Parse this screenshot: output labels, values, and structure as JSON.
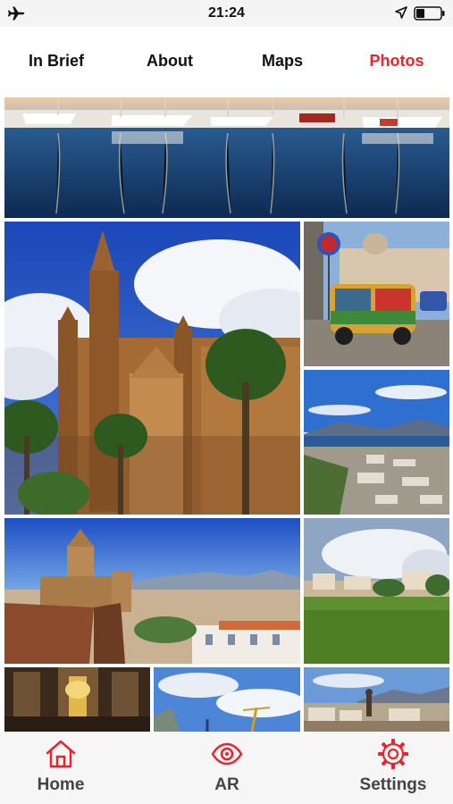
{
  "status_bar": {
    "time": "21:24",
    "left_icon": "airplane-icon",
    "right_icons": [
      "location-arrow-icon",
      "battery-icon"
    ]
  },
  "tabs": [
    {
      "label": "In Brief",
      "active": false
    },
    {
      "label": "About",
      "active": false
    },
    {
      "label": "Maps",
      "active": false
    },
    {
      "label": "Photos",
      "active": true
    }
  ],
  "accent_color": "#e8242d",
  "photos": [
    {
      "subject": "harbor-boats"
    },
    {
      "subject": "cathedral"
    },
    {
      "subject": "tuk-tuk"
    },
    {
      "subject": "aerial-coast"
    },
    {
      "subject": "cathedral-rooftops"
    },
    {
      "subject": "park-lawn"
    },
    {
      "subject": "church-interior"
    },
    {
      "subject": "sky-cranes"
    },
    {
      "subject": "city-mountains"
    }
  ],
  "bottom_nav": [
    {
      "label": "Home",
      "icon": "home-icon"
    },
    {
      "label": "AR",
      "icon": "eye-icon"
    },
    {
      "label": "Settings",
      "icon": "gear-icon"
    }
  ]
}
